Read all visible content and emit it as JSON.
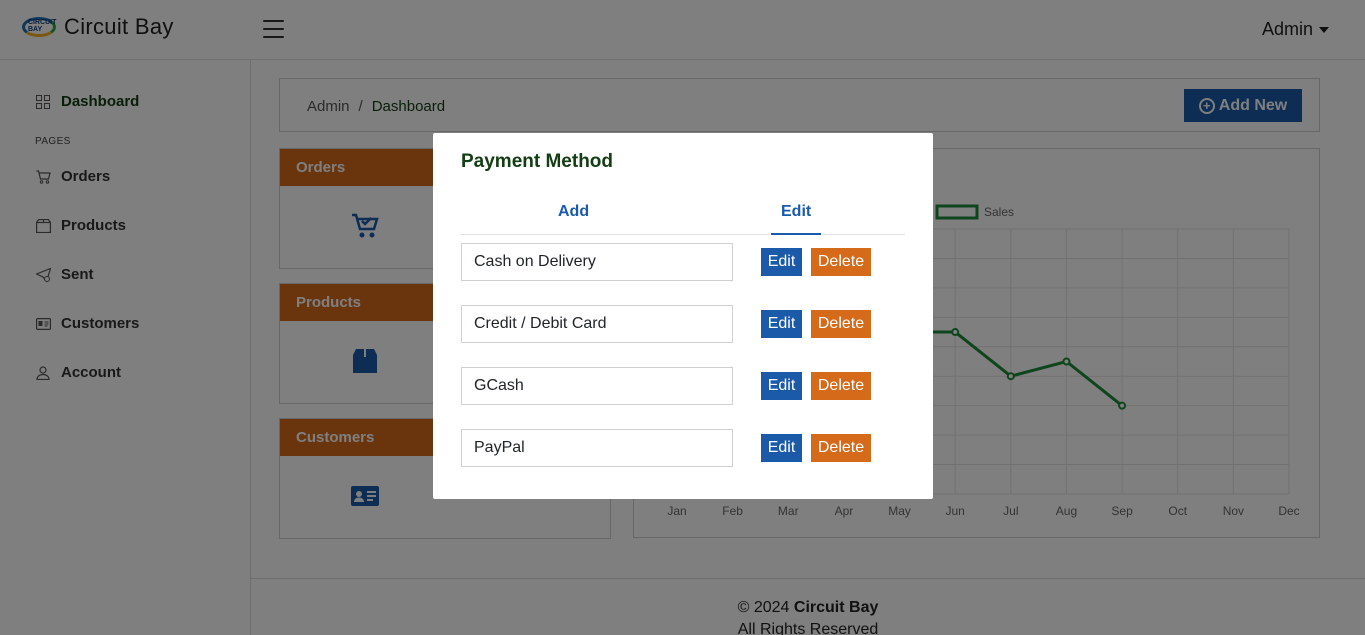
{
  "app": {
    "brand": "Circuit Bay",
    "logo_text": "CIRCUIT BAY",
    "user_menu": "Admin"
  },
  "sidebar": {
    "section_label": "PAGES",
    "items": [
      {
        "label": "Dashboard",
        "icon": "grid-icon"
      },
      {
        "label": "Orders",
        "icon": "cart-icon"
      },
      {
        "label": "Products",
        "icon": "box-icon"
      },
      {
        "label": "Sent",
        "icon": "send-icon"
      },
      {
        "label": "Customers",
        "icon": "id-card-icon"
      },
      {
        "label": "Account",
        "icon": "user-icon"
      }
    ]
  },
  "breadcrumb": {
    "root": "Admin",
    "separator": "/",
    "current": "Dashboard"
  },
  "toolbar": {
    "add_new_label": "Add New"
  },
  "cards": [
    {
      "title": "Orders",
      "icon": "cart-check-icon"
    },
    {
      "title": "Products",
      "icon": "box-icon"
    },
    {
      "title": "Customers",
      "icon": "id-card-icon"
    }
  ],
  "chart_data": {
    "type": "line",
    "categories": [
      "Jan",
      "Feb",
      "Mar",
      "Apr",
      "May",
      "Jun",
      "Jul",
      "Aug",
      "Sep",
      "Oct",
      "Nov",
      "Dec"
    ],
    "series": [
      {
        "name": "Sales",
        "color": "#1f8a3a",
        "values": [
          null,
          null,
          null,
          null,
          55,
          55,
          40,
          45,
          30,
          null,
          null,
          null
        ]
      }
    ],
    "ylim": [
      0,
      90
    ],
    "grid": true,
    "legend": "top"
  },
  "footer": {
    "copyright_prefix": "© 2024",
    "brand": "Circuit Bay",
    "rights": "All Rights Reserved"
  },
  "modal": {
    "title": "Payment Method",
    "tabs": [
      {
        "label": "Add"
      },
      {
        "label": "Edit"
      }
    ],
    "active_tab": "Edit",
    "methods": [
      {
        "value": "Cash on Delivery",
        "edit_label": "Edit",
        "delete_label": "Delete"
      },
      {
        "value": "Credit / Debit Card",
        "edit_label": "Edit",
        "delete_label": "Delete"
      },
      {
        "value": "GCash",
        "edit_label": "Edit",
        "delete_label": "Delete"
      },
      {
        "value": "PayPal",
        "edit_label": "Edit",
        "delete_label": "Delete"
      }
    ]
  },
  "colors": {
    "primary": "#1a5aa8",
    "accent": "#d56a1b",
    "heading": "#133d13",
    "series": "#1f8a3a"
  }
}
